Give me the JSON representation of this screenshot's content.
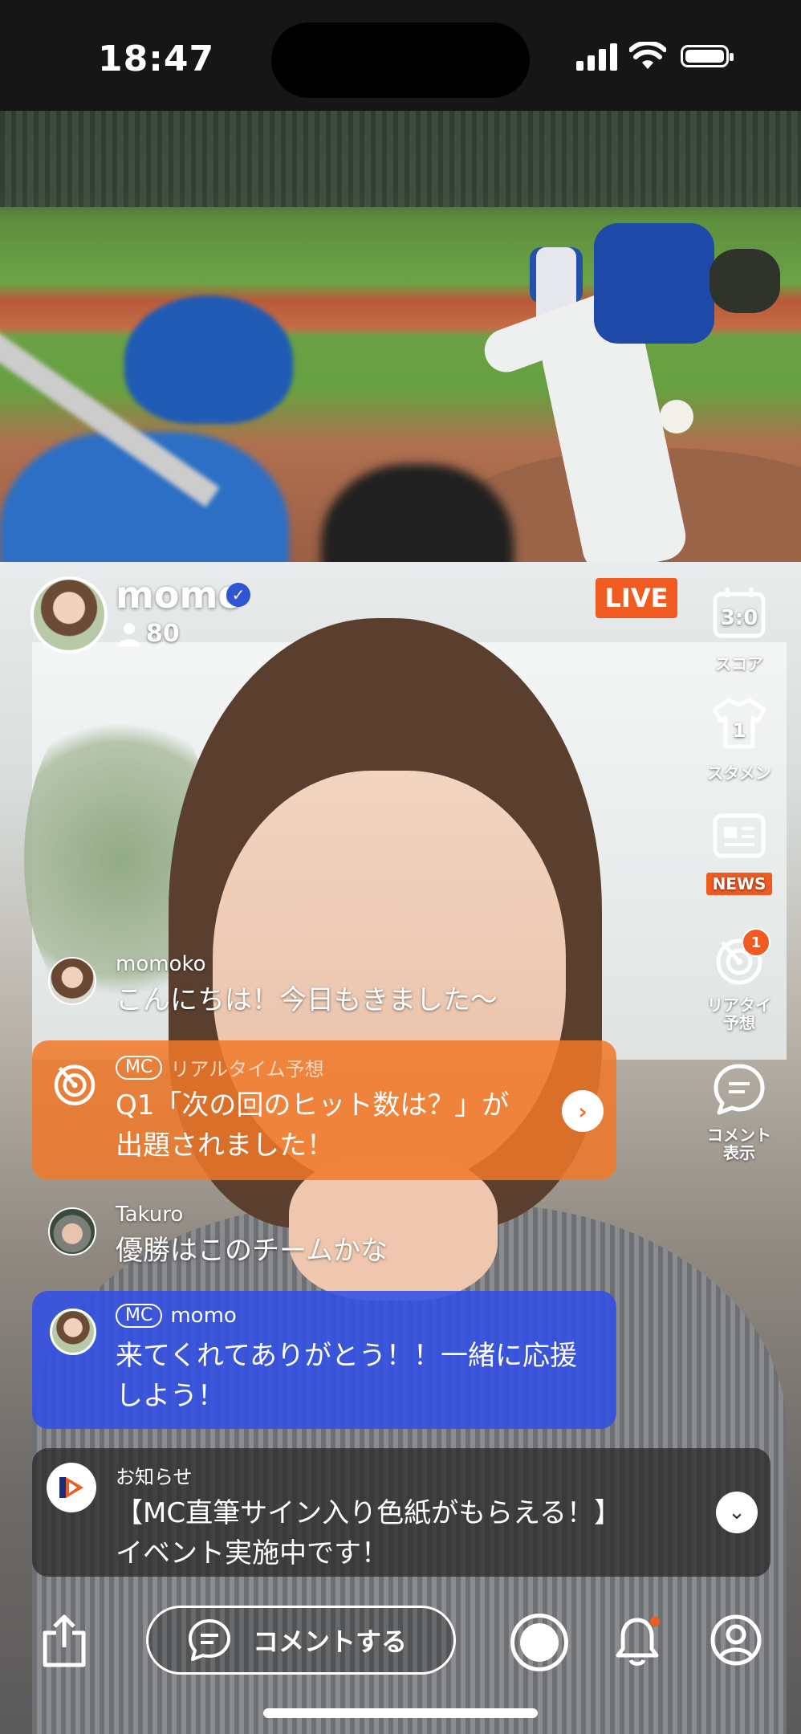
{
  "status_bar": {
    "time": "18:47"
  },
  "stream": {
    "streamer_name": "momo",
    "viewer_count": "80",
    "live_label": "LIVE"
  },
  "side_menu": [
    {
      "icon": "scoreboard-icon",
      "label": "スコア"
    },
    {
      "icon": "jersey-icon",
      "label": "スタメン"
    },
    {
      "icon": "news-icon",
      "label": "NEWS"
    },
    {
      "icon": "realtime-prediction-icon",
      "label": "リアタイ\n予想",
      "badge": "1"
    },
    {
      "icon": "comment-toggle-icon",
      "label": "コメント\n表示"
    }
  ],
  "comments": {
    "c1": {
      "user": "momoko",
      "text": "こんにちは！今日もきました〜"
    },
    "prediction": {
      "badge": "MC",
      "category": "リアルタイム予想",
      "line1": "Q1「次の回のヒット数は？」が",
      "line2": "出題されました！"
    },
    "c2": {
      "user": "Takuro",
      "text": "優勝はこのチームかな"
    },
    "mc": {
      "badge": "MC",
      "user": "momo",
      "line1": "来てくれてありがとう！！一緒に応援",
      "line2": "しよう！"
    },
    "notice": {
      "category": "お知らせ",
      "line1": "【MC直筆サイン入り色紙がもらえる！】",
      "line2": "イベント実施中です！"
    }
  },
  "bottom_bar": {
    "comment_button": "コメントする"
  },
  "colors": {
    "accent_orange": "#f05b22",
    "mc_blue": "#3250e6",
    "verified_blue": "#2f55d4"
  }
}
